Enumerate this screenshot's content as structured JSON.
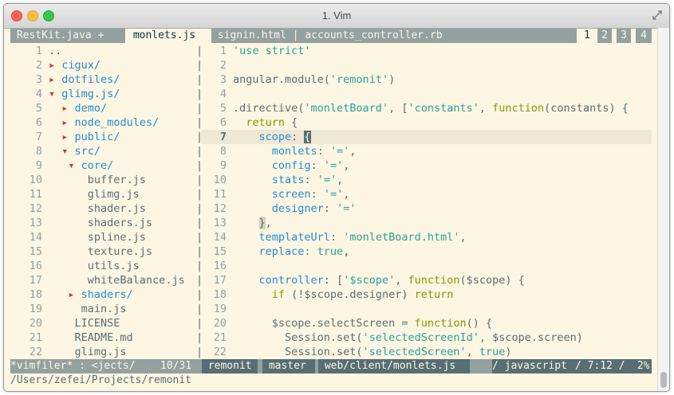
{
  "window": {
    "title": "1. Vim"
  },
  "tabs": {
    "items": [
      {
        "label": " RestKit.java + "
      },
      {
        "label": " monlets.js "
      },
      {
        "label": " signin.html | accounts_controller.rb "
      }
    ],
    "numbers": [
      "1",
      "2",
      "3",
      "4"
    ]
  },
  "filer": {
    "lines": [
      {
        "n": "1",
        "text": "..",
        "kind": "file",
        "indent": ""
      },
      {
        "n": "2",
        "text": "cigux/",
        "kind": "dir",
        "indent": "",
        "arrow": "▸"
      },
      {
        "n": "3",
        "text": "dotfiles/",
        "kind": "dir",
        "indent": "",
        "arrow": "▸"
      },
      {
        "n": "4",
        "text": "glimg.js/",
        "kind": "dir",
        "indent": "",
        "arrow": "▾"
      },
      {
        "n": "5",
        "text": "demo/",
        "kind": "dir",
        "indent": "  ",
        "arrow": "▸"
      },
      {
        "n": "6",
        "text": "node_modules/",
        "kind": "dir",
        "indent": "  ",
        "arrow": "▸"
      },
      {
        "n": "7",
        "text": "public/",
        "kind": "dir",
        "indent": "  ",
        "arrow": "▸"
      },
      {
        "n": "8",
        "text": "src/",
        "kind": "dir",
        "indent": "  ",
        "arrow": "▾"
      },
      {
        "n": "9",
        "text": "core/",
        "kind": "dir",
        "indent": "   ",
        "arrow": "▾"
      },
      {
        "n": "10",
        "text": "buffer.js",
        "kind": "file",
        "indent": "      "
      },
      {
        "n": "11",
        "text": "glimg.js",
        "kind": "file",
        "indent": "      "
      },
      {
        "n": "12",
        "text": "shader.js",
        "kind": "file",
        "indent": "      "
      },
      {
        "n": "13",
        "text": "shaders.js",
        "kind": "file",
        "indent": "      "
      },
      {
        "n": "14",
        "text": "spline.js",
        "kind": "file",
        "indent": "      "
      },
      {
        "n": "15",
        "text": "texture.js",
        "kind": "file",
        "indent": "      "
      },
      {
        "n": "16",
        "text": "utils.js",
        "kind": "file",
        "indent": "      "
      },
      {
        "n": "17",
        "text": "whiteBalance.js",
        "kind": "file",
        "indent": "      "
      },
      {
        "n": "18",
        "text": "shaders/",
        "kind": "dir",
        "indent": "   ",
        "arrow": "▸"
      },
      {
        "n": "19",
        "text": "main.js",
        "kind": "file",
        "indent": "     "
      },
      {
        "n": "20",
        "text": "LICENSE",
        "kind": "file",
        "indent": "    "
      },
      {
        "n": "21",
        "text": "README.md",
        "kind": "file",
        "indent": "    "
      },
      {
        "n": "22",
        "text": "glimg.js",
        "kind": "file",
        "indent": "    "
      }
    ]
  },
  "code": {
    "cursor_line": "7",
    "lines": [
      {
        "n": "1",
        "tokens": [
          [
            "str",
            "'use strict'"
          ]
        ]
      },
      {
        "n": "2",
        "tokens": []
      },
      {
        "n": "3",
        "tokens": [
          [
            "id",
            "angular.module("
          ],
          [
            "str",
            "'remonit'"
          ],
          [
            "id",
            ")"
          ]
        ]
      },
      {
        "n": "4",
        "tokens": []
      },
      {
        "n": "5",
        "tokens": [
          [
            "id",
            ".directive("
          ],
          [
            "str",
            "'monletBoard'"
          ],
          [
            "id",
            ", ["
          ],
          [
            "str",
            "'constants'"
          ],
          [
            "id",
            ", "
          ],
          [
            "kw",
            "function"
          ],
          [
            "id",
            "(constants) {"
          ]
        ]
      },
      {
        "n": "6",
        "tokens": [
          [
            "id",
            "  "
          ],
          [
            "kw",
            "return"
          ],
          [
            "id",
            " {"
          ]
        ]
      },
      {
        "n": "7",
        "tokens": [
          [
            "id",
            "    "
          ],
          [
            "key",
            "scope"
          ],
          [
            "id",
            ": "
          ],
          [
            "cur",
            "{"
          ]
        ]
      },
      {
        "n": "8",
        "tokens": [
          [
            "id",
            "      "
          ],
          [
            "key",
            "monlets"
          ],
          [
            "id",
            ": "
          ],
          [
            "str",
            "'='"
          ],
          [
            "id",
            ","
          ]
        ]
      },
      {
        "n": "9",
        "tokens": [
          [
            "id",
            "      "
          ],
          [
            "key",
            "config"
          ],
          [
            "id",
            ": "
          ],
          [
            "str",
            "'='"
          ],
          [
            "id",
            ","
          ]
        ]
      },
      {
        "n": "10",
        "tokens": [
          [
            "id",
            "      "
          ],
          [
            "key",
            "stats"
          ],
          [
            "id",
            ": "
          ],
          [
            "str",
            "'='"
          ],
          [
            "id",
            ","
          ]
        ]
      },
      {
        "n": "11",
        "tokens": [
          [
            "id",
            "      "
          ],
          [
            "key",
            "screen"
          ],
          [
            "id",
            ": "
          ],
          [
            "str",
            "'='"
          ],
          [
            "id",
            ","
          ]
        ]
      },
      {
        "n": "12",
        "tokens": [
          [
            "id",
            "      "
          ],
          [
            "key",
            "designer"
          ],
          [
            "id",
            ": "
          ],
          [
            "str",
            "'='"
          ]
        ]
      },
      {
        "n": "13",
        "tokens": [
          [
            "id",
            "    "
          ],
          [
            "mbr",
            "}"
          ],
          [
            "id",
            ","
          ]
        ]
      },
      {
        "n": "14",
        "tokens": [
          [
            "id",
            "    "
          ],
          [
            "key",
            "templateUrl"
          ],
          [
            "id",
            ": "
          ],
          [
            "str",
            "'monletBoard.html'"
          ],
          [
            "id",
            ","
          ]
        ]
      },
      {
        "n": "15",
        "tokens": [
          [
            "id",
            "    "
          ],
          [
            "key",
            "replace"
          ],
          [
            "id",
            ": "
          ],
          [
            "lit",
            "true"
          ],
          [
            "id",
            ","
          ]
        ]
      },
      {
        "n": "16",
        "tokens": []
      },
      {
        "n": "17",
        "tokens": [
          [
            "id",
            "    "
          ],
          [
            "key",
            "controller"
          ],
          [
            "id",
            ": ["
          ],
          [
            "str",
            "'$scope'"
          ],
          [
            "id",
            ", "
          ],
          [
            "kw",
            "function"
          ],
          [
            "id",
            "($scope) {"
          ]
        ]
      },
      {
        "n": "18",
        "tokens": [
          [
            "id",
            "      "
          ],
          [
            "kw",
            "if"
          ],
          [
            "id",
            " (!$scope.designer) "
          ],
          [
            "kw",
            "return"
          ]
        ]
      },
      {
        "n": "19",
        "tokens": []
      },
      {
        "n": "20",
        "tokens": [
          [
            "id",
            "      $scope.selectScreen = "
          ],
          [
            "kw",
            "function"
          ],
          [
            "id",
            "() {"
          ]
        ]
      },
      {
        "n": "21",
        "tokens": [
          [
            "id",
            "        Session.set("
          ],
          [
            "str",
            "'selectedScreenId'"
          ],
          [
            "id",
            ", $scope.screen)"
          ]
        ]
      },
      {
        "n": "22",
        "tokens": [
          [
            "id",
            "        Session.set("
          ],
          [
            "str",
            "'selectedScreen'"
          ],
          [
            "id",
            ", "
          ],
          [
            "lit",
            "true"
          ],
          [
            "id",
            ")"
          ]
        ]
      }
    ]
  },
  "separator": "|",
  "status": {
    "left": "*vimfiler* : <jects/",
    "count": "10/31",
    "project": " remonit ",
    "branch": " master ",
    "path": " web/client/monlets.js ",
    "filetype": "/ javascript ",
    "position": "/ 7:12 /",
    "percent": " 2%"
  },
  "cmdline": "/Users/zefei/Projects/remonit",
  "colors": {
    "background": "#fdf6e3",
    "tab_inactive": "#93a1a1",
    "string": "#2aa198",
    "keyword": "#859900",
    "directory": "#268bd2",
    "arrow": "#dc322f"
  }
}
